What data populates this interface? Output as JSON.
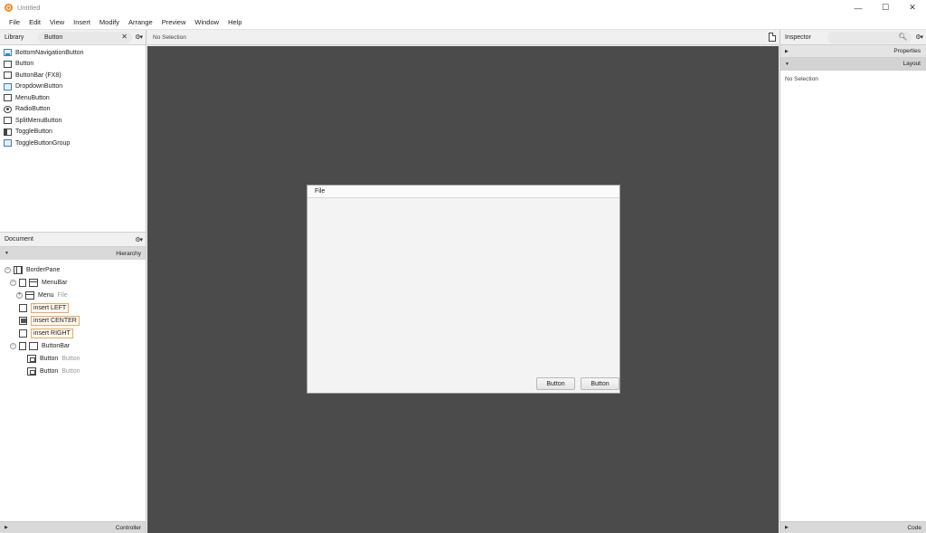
{
  "window": {
    "title": "Untitled",
    "minimize": "—",
    "maximize": "☐",
    "close": "✕"
  },
  "menubar": [
    "File",
    "Edit",
    "View",
    "Insert",
    "Modify",
    "Arrange",
    "Preview",
    "Window",
    "Help"
  ],
  "library": {
    "title": "Library",
    "search_value": "Button",
    "items": [
      "BottomNavigationButton",
      "Button",
      "ButtonBar  (FX8)",
      "DropdownButton",
      "MenuButton",
      "RadioButton",
      "SplitMenuButton",
      "ToggleButton",
      "ToggleButtonGroup"
    ]
  },
  "document": {
    "title": "Document",
    "hierarchy_label": "Hierarchy",
    "tree": {
      "border_pane": "BorderPane",
      "menu_bar": "MenuBar",
      "menu": "Menu",
      "menu_sub": "File",
      "insert_left": "insert LEFT",
      "insert_center": "insert CENTER",
      "insert_right": "insert RIGHT",
      "button_bar": "ButtonBar",
      "button1": "Button",
      "button1_sub": "Button",
      "button2": "Button",
      "button2_sub": "Button"
    },
    "controller_label": "Controller"
  },
  "center": {
    "selection_text": "No Selection"
  },
  "preview": {
    "menu_label": "File",
    "button1": "Button",
    "button2": "Button"
  },
  "inspector": {
    "title": "Inspector",
    "properties_label": "Properties",
    "layout_label": "Layout",
    "no_selection": "No Selection",
    "code_label": "Code"
  },
  "colors": {
    "canvas": "#4b4b4b",
    "app_icon": "#f08a24",
    "insert_tag_border": "#e8a866"
  }
}
